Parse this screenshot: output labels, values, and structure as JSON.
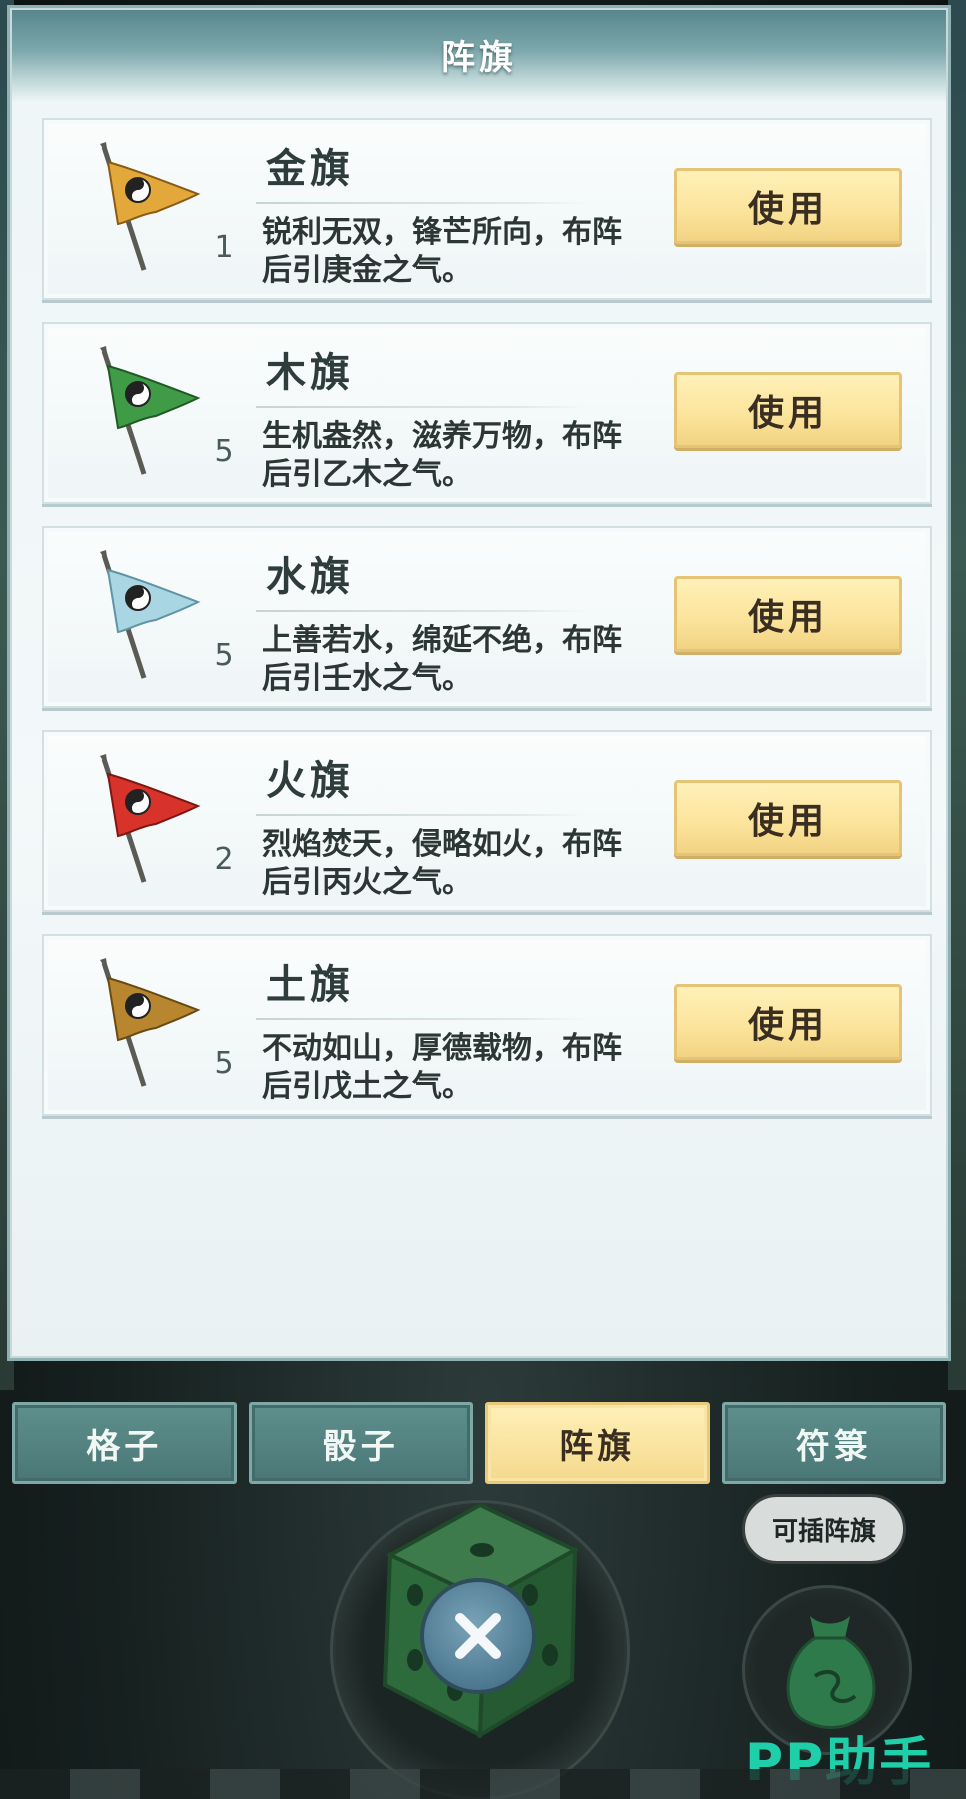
{
  "panel": {
    "title": "阵旗"
  },
  "flags": [
    {
      "name": "金旗",
      "count": "1",
      "desc": "锐利无双，锋芒所向，布阵后引庚金之气。",
      "button": "使用",
      "color": "#e2a93a",
      "icon": "gold-flag-icon"
    },
    {
      "name": "木旗",
      "count": "5",
      "desc": "生机盎然，滋养万物，布阵后引乙木之气。",
      "button": "使用",
      "color": "#3f9b46",
      "icon": "wood-flag-icon"
    },
    {
      "name": "水旗",
      "count": "5",
      "desc": "上善若水，绵延不绝，布阵后引壬水之气。",
      "button": "使用",
      "color": "#a9d6e2",
      "icon": "water-flag-icon"
    },
    {
      "name": "火旗",
      "count": "2",
      "desc": "烈焰焚天，侵略如火，布阵后引丙火之气。",
      "button": "使用",
      "color": "#d8332b",
      "icon": "fire-flag-icon"
    },
    {
      "name": "土旗",
      "count": "5",
      "desc": "不动如山，厚德载物，布阵后引戊土之气。",
      "button": "使用",
      "color": "#b7862f",
      "icon": "earth-flag-icon"
    }
  ],
  "tabs": [
    {
      "label": "格子",
      "active": false
    },
    {
      "label": "骰子",
      "active": false
    },
    {
      "label": "阵旗",
      "active": true
    },
    {
      "label": "符箓",
      "active": false
    }
  ],
  "bag": {
    "hint": "可插阵旗",
    "icon": "pouch-icon"
  },
  "dice": {
    "icon": "dice-icon",
    "close_icon": "close-icon"
  },
  "watermark": "PP助手"
}
